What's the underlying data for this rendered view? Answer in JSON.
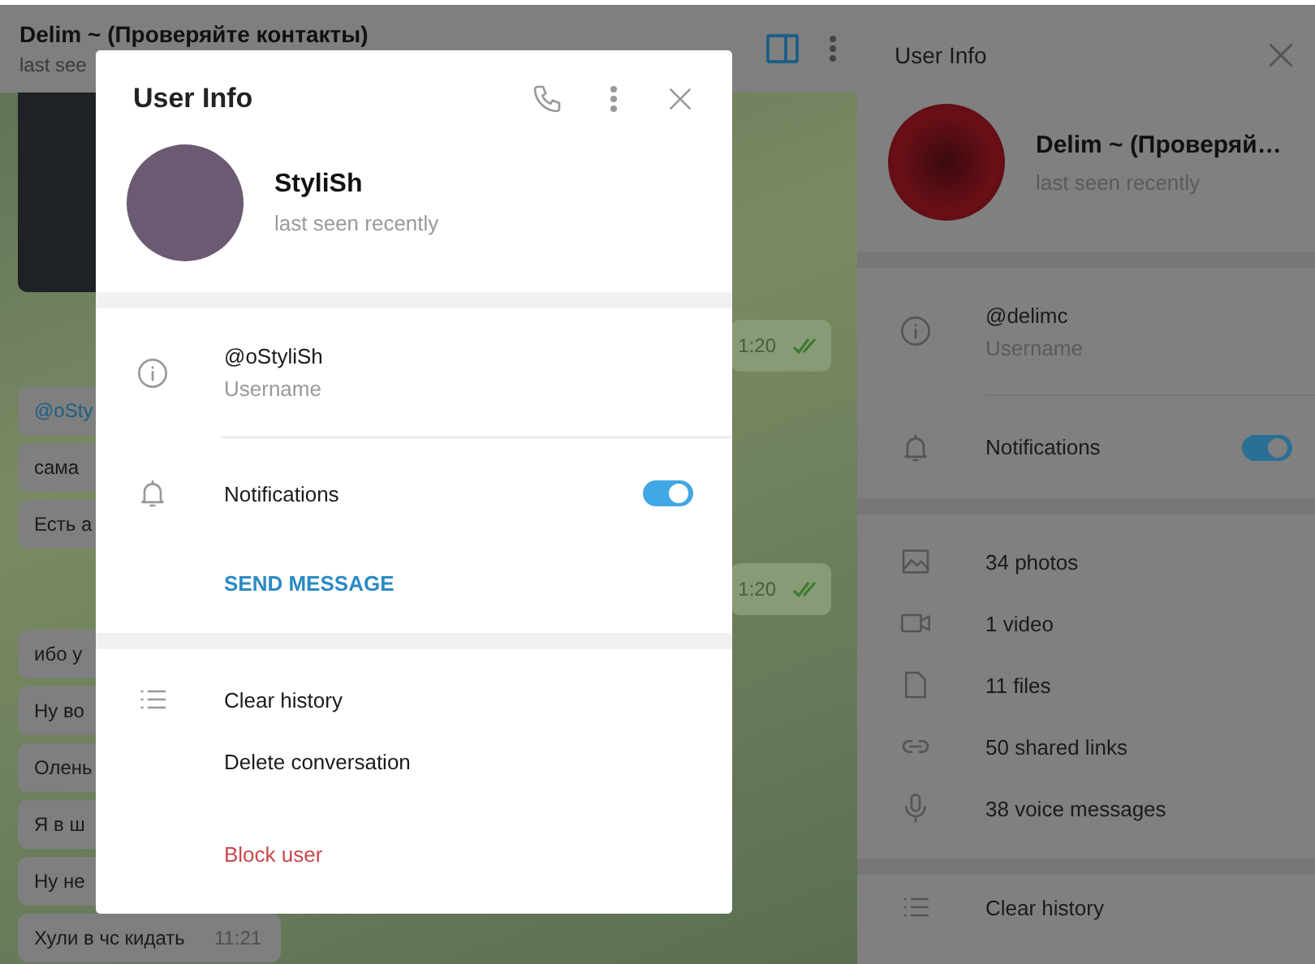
{
  "chat": {
    "title": "Delim ~ (Проверяйте контакты)",
    "status": "last see",
    "messages": [
      {
        "kind": "photo"
      },
      {
        "kind": "outgoing",
        "time": "1:20",
        "read": true
      },
      {
        "kind": "incoming",
        "text": "@oSty",
        "link": true
      },
      {
        "kind": "incoming",
        "text": "сама"
      },
      {
        "kind": "incoming",
        "text": "Есть а"
      },
      {
        "kind": "outgoing",
        "time": "1:20",
        "read": true
      },
      {
        "kind": "incoming",
        "text": "ибо у"
      },
      {
        "kind": "incoming",
        "text": "Ну во"
      },
      {
        "kind": "incoming",
        "text": "Олень"
      },
      {
        "kind": "incoming",
        "text": "Я в ш"
      },
      {
        "kind": "incoming",
        "text": "Ну не"
      },
      {
        "kind": "incoming",
        "text": "Хули в чс кидать",
        "time": "11:21"
      }
    ]
  },
  "side_panel": {
    "title": "User Info",
    "name": "Delim ~ (Проверяй…",
    "status": "last seen recently",
    "username": "@delimc",
    "username_label": "Username",
    "notifications": {
      "label": "Notifications",
      "on": true
    },
    "media": [
      {
        "kind": "photo",
        "label": "34 photos"
      },
      {
        "kind": "video",
        "label": "1 video"
      },
      {
        "kind": "file",
        "label": "11 files"
      },
      {
        "kind": "link",
        "label": "50 shared links"
      },
      {
        "kind": "voice",
        "label": "38 voice messages"
      }
    ],
    "actions": [
      {
        "label": "Clear history"
      }
    ]
  },
  "dialog": {
    "title": "User Info",
    "name": "StyliSh",
    "status": "last seen recently",
    "username": "@oStyliSh",
    "username_label": "Username",
    "notifications": {
      "label": "Notifications",
      "on": true
    },
    "send_message": "SEND MESSAGE",
    "actions": [
      {
        "label": "Clear history",
        "kind": "normal"
      },
      {
        "label": "Delete conversation",
        "kind": "normal"
      },
      {
        "label": "Block user",
        "kind": "danger"
      }
    ]
  }
}
